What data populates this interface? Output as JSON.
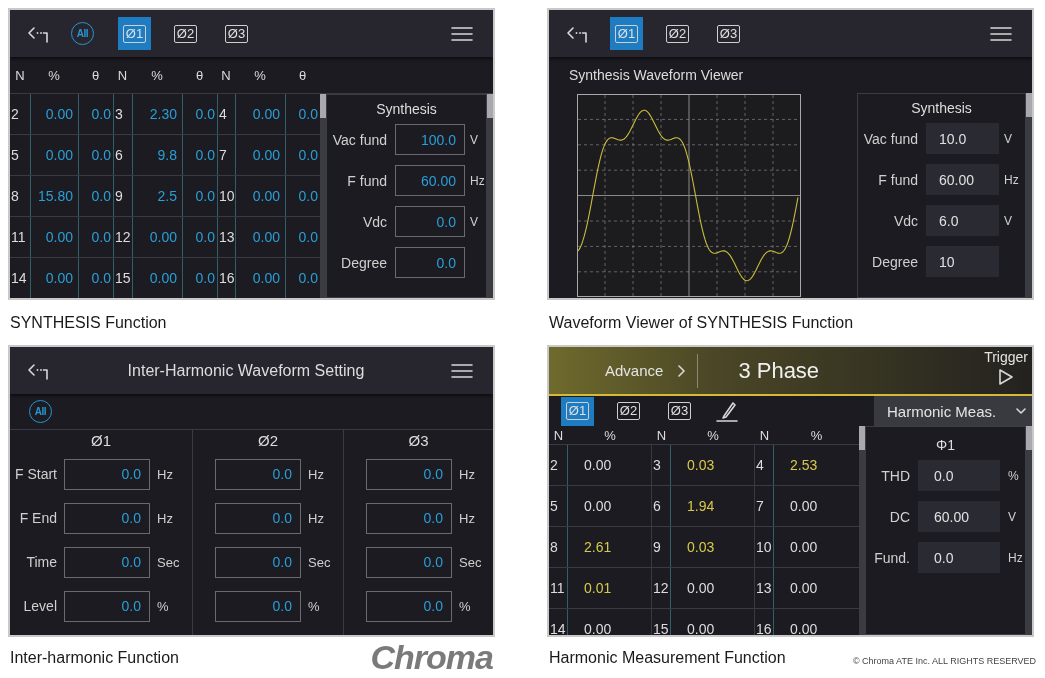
{
  "rows": [
    {
      "figures": [
        {
          "screen": {
            "kind": "synthesis_table",
            "toolbar": {
              "all_button": "All",
              "tabs": [
                {
                  "label": "Ø1",
                  "selected": true
                },
                {
                  "label": "Ø2",
                  "selected": false
                },
                {
                  "label": "Ø3",
                  "selected": false
                }
              ]
            },
            "table": {
              "columns": [
                "N",
                "%",
                "θ",
                "N",
                "%",
                "θ",
                "N",
                "%",
                "θ"
              ],
              "rows": [
                [
                  "2",
                  "0.00",
                  "0.0",
                  "3",
                  "2.30",
                  "0.0",
                  "4",
                  "0.00",
                  "0.0"
                ],
                [
                  "5",
                  "0.00",
                  "0.0",
                  "6",
                  "9.8",
                  "0.0",
                  "7",
                  "0.00",
                  "0.0"
                ],
                [
                  "8",
                  "15.80",
                  "0.0",
                  "9",
                  "2.5",
                  "0.0",
                  "10",
                  "0.00",
                  "0.0"
                ],
                [
                  "11",
                  "0.00",
                  "0.0",
                  "12",
                  "0.00",
                  "0.0",
                  "13",
                  "0.00",
                  "0.0"
                ],
                [
                  "14",
                  "0.00",
                  "0.0",
                  "15",
                  "0.00",
                  "0.0",
                  "16",
                  "0.00",
                  "0.0"
                ]
              ]
            },
            "side_panel": {
              "title": "Synthesis",
              "fields": [
                {
                  "label": "Vac fund",
                  "value": "100.0",
                  "unit": "V"
                },
                {
                  "label": "F fund",
                  "value": "60.00",
                  "unit": "Hz"
                },
                {
                  "label": "Vdc",
                  "value": "0.0",
                  "unit": "V"
                },
                {
                  "label": "Degree",
                  "value": "0.0"
                }
              ]
            }
          },
          "caption": "SYNTHESIS Function"
        },
        {
          "screen": {
            "kind": "waveform_viewer",
            "toolbar": {
              "tabs": [
                {
                  "label": "Ø1",
                  "selected": true
                },
                {
                  "label": "Ø2",
                  "selected": false
                },
                {
                  "label": "Ø3",
                  "selected": false
                }
              ]
            },
            "heading": "Synthesis Waveform Viewer",
            "side_panel": {
              "title": "Synthesis",
              "fields": [
                {
                  "label": "Vac fund",
                  "value": "10.0",
                  "unit": "V"
                },
                {
                  "label": "F fund",
                  "value": "60.00",
                  "unit": "Hz"
                },
                {
                  "label": "Vdc",
                  "value": "6.0",
                  "unit": "V"
                },
                {
                  "label": "Degree",
                  "value": "10"
                }
              ]
            }
          },
          "caption": "Waveform Viewer of SYNTHESIS Function"
        }
      ]
    },
    {
      "figures": [
        {
          "screen": {
            "kind": "inter_harmonic",
            "toolbar": {
              "title": "Inter-Harmonic Waveform Setting"
            },
            "all_button": "All",
            "phases": [
              {
                "heading": "Ø1",
                "fields": [
                  {
                    "label": "F Start",
                    "value": "0.0",
                    "unit": "Hz"
                  },
                  {
                    "label": "F End",
                    "value": "0.0",
                    "unit": "Hz"
                  },
                  {
                    "label": "Time",
                    "value": "0.0",
                    "unit": "Sec"
                  },
                  {
                    "label": "Level",
                    "value": "0.0",
                    "unit": "%"
                  }
                ]
              },
              {
                "heading": "Ø2",
                "fields": [
                  {
                    "value": "0.0",
                    "unit": "Hz"
                  },
                  {
                    "value": "0.0",
                    "unit": "Hz"
                  },
                  {
                    "value": "0.0",
                    "unit": "Sec"
                  },
                  {
                    "value": "0.0",
                    "unit": "%"
                  }
                ]
              },
              {
                "heading": "Ø3",
                "fields": [
                  {
                    "value": "0.0",
                    "unit": "Hz"
                  },
                  {
                    "value": "0.0",
                    "unit": "Hz"
                  },
                  {
                    "value": "0.0",
                    "unit": "Sec"
                  },
                  {
                    "value": "0.0",
                    "unit": "%"
                  }
                ]
              }
            ]
          },
          "caption": "Inter-harmonic Function",
          "logo": "Chroma"
        },
        {
          "screen": {
            "kind": "harmonic_meas",
            "top_bar": {
              "mode": "Advance",
              "title": "3 Phase",
              "trigger": "Trigger"
            },
            "tabs": [
              {
                "label": "Ø1",
                "selected": true
              },
              {
                "label": "Ø2",
                "selected": false
              },
              {
                "label": "Ø3",
                "selected": false
              }
            ],
            "dropdown": "Harmonic Meas.",
            "table": {
              "columns": [
                "N",
                "%",
                "N",
                "%",
                "N",
                "%"
              ],
              "rows": [
                [
                  {
                    "text": "2"
                  },
                  {
                    "text": "0.00",
                    "highlighted": false
                  },
                  {
                    "text": "3"
                  },
                  {
                    "text": "0.03",
                    "highlighted": true
                  },
                  {
                    "text": "4"
                  },
                  {
                    "text": "2.53",
                    "highlighted": true
                  }
                ],
                [
                  {
                    "text": "5"
                  },
                  {
                    "text": "0.00",
                    "highlighted": false
                  },
                  {
                    "text": "6"
                  },
                  {
                    "text": "1.94",
                    "highlighted": true
                  },
                  {
                    "text": "7"
                  },
                  {
                    "text": "0.00",
                    "highlighted": false
                  }
                ],
                [
                  {
                    "text": "8"
                  },
                  {
                    "text": "2.61",
                    "highlighted": true
                  },
                  {
                    "text": "9"
                  },
                  {
                    "text": "0.03",
                    "highlighted": true
                  },
                  {
                    "text": "10"
                  },
                  {
                    "text": "0.00",
                    "highlighted": false
                  }
                ],
                [
                  {
                    "text": "11"
                  },
                  {
                    "text": "0.01",
                    "highlighted": true
                  },
                  {
                    "text": "12"
                  },
                  {
                    "text": "0.00",
                    "highlighted": false
                  },
                  {
                    "text": "13"
                  },
                  {
                    "text": "0.00",
                    "highlighted": false
                  }
                ],
                [
                  {
                    "text": "14"
                  },
                  {
                    "text": "0.00",
                    "highlighted": false
                  },
                  {
                    "text": "15"
                  },
                  {
                    "text": "0.00",
                    "highlighted": false
                  },
                  {
                    "text": "16"
                  },
                  {
                    "text": "0.00",
                    "highlighted": false
                  }
                ]
              ]
            },
            "side_panel": {
              "title": "Φ1",
              "fields": [
                {
                  "label": "THD",
                  "value": "0.0",
                  "unit": "%"
                },
                {
                  "label": "DC",
                  "value": "60.00",
                  "unit": "V"
                },
                {
                  "label": "Fund.",
                  "value": "0.0",
                  "unit": "Hz"
                }
              ]
            }
          },
          "caption": "Harmonic Measurement Function",
          "copyright": "© Chroma ATE Inc. ALL RIGHTS RESERVED"
        }
      ]
    }
  ]
}
